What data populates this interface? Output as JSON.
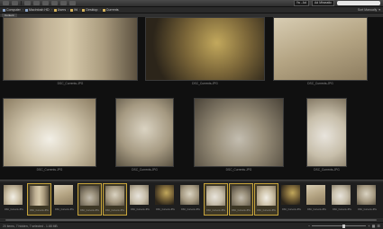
{
  "toolbar": {
    "workspace": "Ad Mirasstic",
    "view_menu": "Ya - Ad"
  },
  "breadcrumb": [
    "Computer",
    "Macintosh HD",
    "Users",
    "lfd",
    "Desktop",
    "Currents"
  ],
  "pathbar_right": "Sort Manually",
  "tab": "Content",
  "main_images": [
    {
      "caption": "DSC_Currents.JPG",
      "pat": "p1"
    },
    {
      "caption": "DSC_Currents.JPG",
      "pat": "p2"
    },
    {
      "caption": "DSC_Currents.JPG",
      "pat": "p3"
    },
    {
      "caption": "DSC_Currents.JPG",
      "pat": "p4"
    },
    {
      "caption": "DSC_Currents.JPG",
      "pat": "p5"
    },
    {
      "caption": "DSC_Currents.JPG",
      "pat": "p6"
    },
    {
      "caption": "DSC_Currents.JPG",
      "pat": "p7"
    }
  ],
  "filmstrip": [
    {
      "caption": "DSC_Currents.JPG",
      "selected": false,
      "pat": "p4"
    },
    {
      "caption": "DSC_Currents.JPG",
      "selected": true,
      "pat": "p1"
    },
    {
      "caption": "DSC_Currents.JPG",
      "selected": false,
      "pat": "p3"
    },
    {
      "caption": "DSC_Currents.JPG",
      "selected": true,
      "pat": "p6"
    },
    {
      "caption": "DSC_Currents.JPG",
      "selected": true,
      "pat": "p5"
    },
    {
      "caption": "DSC_Currents.JPG",
      "selected": false,
      "pat": "p7"
    },
    {
      "caption": "DSC_Currents.JPG",
      "selected": false,
      "pat": "p2"
    },
    {
      "caption": "DSC_Currents.JPG",
      "selected": false,
      "pat": "p5"
    },
    {
      "caption": "DSC_Currents.JPG",
      "selected": true,
      "pat": "p7"
    },
    {
      "caption": "DSC_Currents.JPG",
      "selected": true,
      "pat": "p6"
    },
    {
      "caption": "DSC_Currents.JPG",
      "selected": true,
      "pat": "p4"
    },
    {
      "caption": "DSC_Currents.JPG",
      "selected": false,
      "pat": "p2"
    },
    {
      "caption": "DSC_Currents.JPG",
      "selected": false,
      "pat": "p3"
    },
    {
      "caption": "DSC_Currents.JPG",
      "selected": false,
      "pat": "p7"
    },
    {
      "caption": "DSC_Currents.JPG",
      "selected": false,
      "pat": "p5"
    }
  ],
  "status": {
    "text": "20 items, 7 hidden, 7 selected - 1.68 MB"
  }
}
